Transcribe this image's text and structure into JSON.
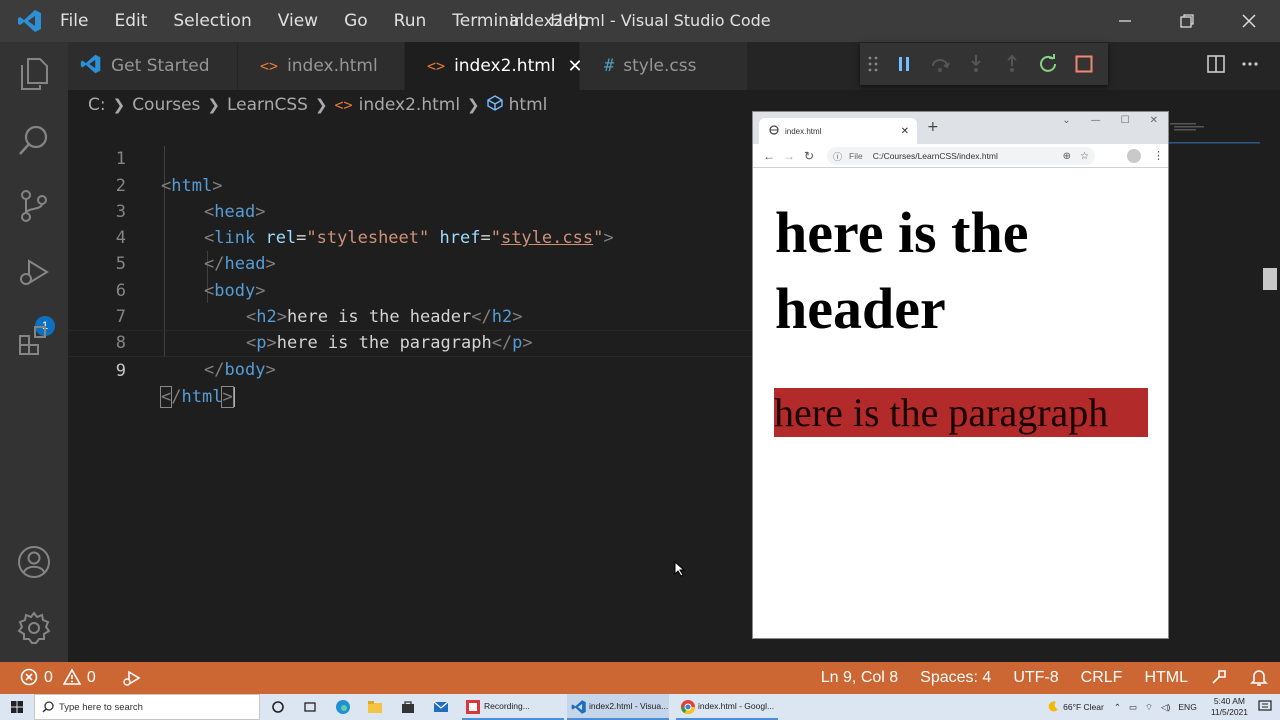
{
  "window": {
    "title": "index2.html - Visual Studio Code",
    "menu": [
      "File",
      "Edit",
      "Selection",
      "View",
      "Go",
      "Run",
      "Terminal",
      "Help"
    ]
  },
  "activity_bar": {
    "icons": [
      "explorer-icon",
      "search-icon",
      "source-control-icon",
      "run-debug-icon",
      "extensions-icon",
      "account-icon",
      "settings-gear-icon"
    ],
    "debug_badge": "1"
  },
  "tabs": [
    {
      "label": "Get Started",
      "icon": "vscode-icon",
      "active": false
    },
    {
      "label": "index.html",
      "icon": "<>",
      "active": false
    },
    {
      "label": "index2.html",
      "icon": "<>",
      "active": true
    },
    {
      "label": "style.css",
      "icon": "#",
      "active": false
    }
  ],
  "breadcrumb": [
    "C:",
    "Courses",
    "LearnCSS",
    "index2.html",
    "html"
  ],
  "editor": {
    "lines": [
      "1",
      "2",
      "3",
      "4",
      "5",
      "6",
      "7",
      "8",
      "9"
    ],
    "code": {
      "l1": "html",
      "l2": "head",
      "l3_tag": "link",
      "l3_attr1": "rel",
      "l3_val1": "\"stylesheet\"",
      "l3_attr2": "href",
      "l3_val2": "style.css",
      "l4": "head",
      "l5": "body",
      "l6_tag": "h2",
      "l6_text": "here is the header",
      "l7_tag": "p",
      "l7_text": "here is the paragraph",
      "l8": "body",
      "l9": "html"
    }
  },
  "browser": {
    "tab_title": "index.html",
    "address_label": "File",
    "address": "C:/Courses/LearnCSS/index.html",
    "heading": "here is the header",
    "paragraph": "here is the paragraph",
    "paragraph_bg": "#b22a2a"
  },
  "status_bar": {
    "errors": "0",
    "warnings": "0",
    "position": "Ln 9, Col 8",
    "spaces": "Spaces: 4",
    "encoding": "UTF-8",
    "eol": "CRLF",
    "language": "HTML",
    "color": "#cc6633"
  },
  "taskbar": {
    "search_placeholder": "Type here to search",
    "apps": [
      {
        "label": "Recording..."
      },
      {
        "label": "index2.html - Visua..."
      },
      {
        "label": "index.html - Googl..."
      }
    ],
    "weather": "66°F  Clear",
    "lang": "ENG",
    "time": "5:40 AM",
    "date": "11/5/2021"
  }
}
